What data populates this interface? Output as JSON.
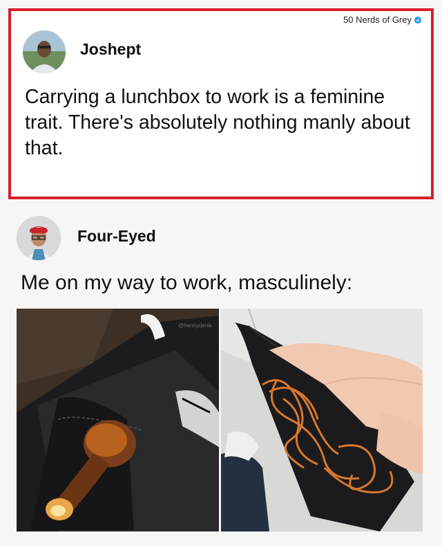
{
  "watermark": {
    "text": "50 Nerds of Grey"
  },
  "post": {
    "author": "Joshept",
    "text": "Carrying a lunchbox to work is a feminine trait. There's absolutely nothing manly about that."
  },
  "reply": {
    "author": "Four-Eyed",
    "text": "Me on my way to work, masculinely:",
    "photo_watermark": "@hennydenik"
  },
  "colors": {
    "highlight_border": "#d81f2a",
    "verified": "#1d9bf0"
  },
  "icons": [
    "verified-badge-icon"
  ]
}
